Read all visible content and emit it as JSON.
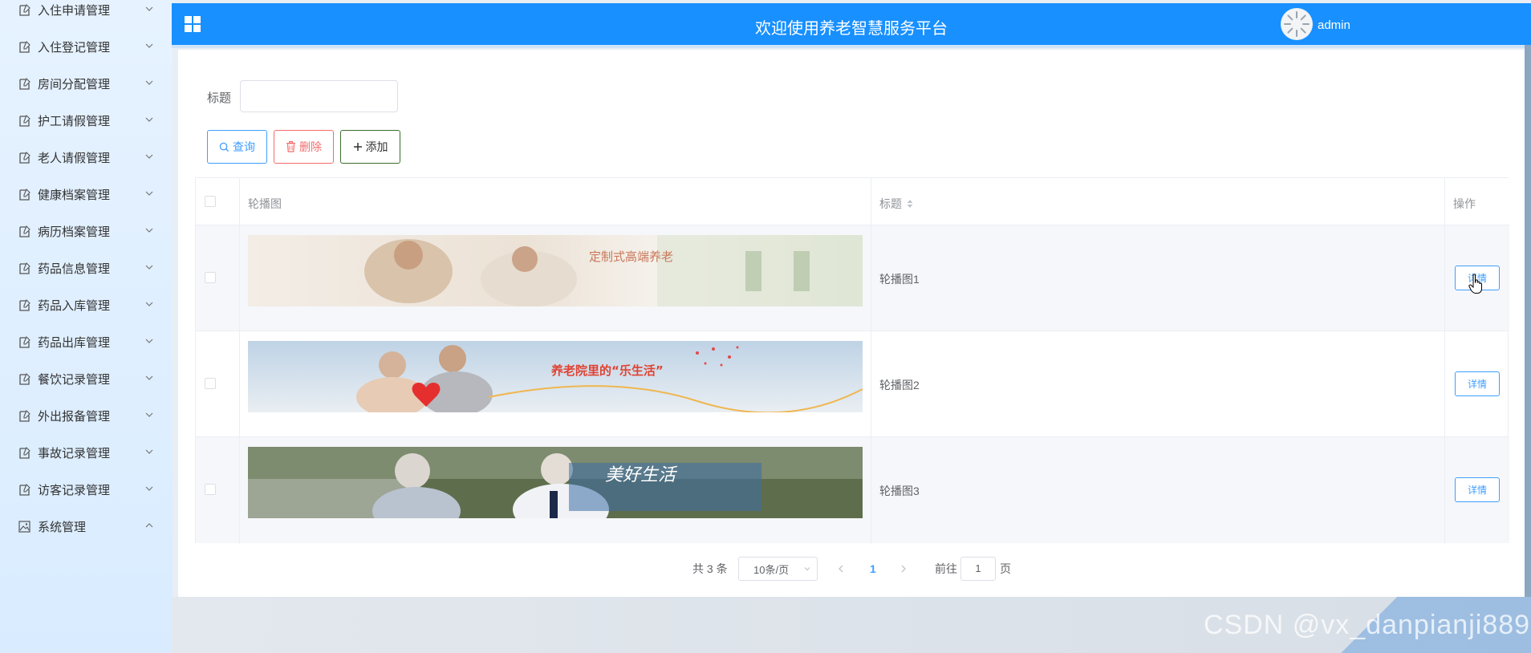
{
  "header": {
    "title": "欢迎使用养老智慧服务平台",
    "username": "admin"
  },
  "sidebar": {
    "items": [
      {
        "label": "入住申请管理",
        "icon": "document-icon",
        "expanded": false
      },
      {
        "label": "入住登记管理",
        "icon": "document-icon",
        "expanded": false
      },
      {
        "label": "房间分配管理",
        "icon": "document-icon",
        "expanded": false
      },
      {
        "label": "护工请假管理",
        "icon": "document-icon",
        "expanded": false
      },
      {
        "label": "老人请假管理",
        "icon": "document-icon",
        "expanded": false
      },
      {
        "label": "健康档案管理",
        "icon": "document-icon",
        "expanded": false
      },
      {
        "label": "病历档案管理",
        "icon": "document-icon",
        "expanded": false
      },
      {
        "label": "药品信息管理",
        "icon": "document-icon",
        "expanded": false
      },
      {
        "label": "药品入库管理",
        "icon": "document-icon",
        "expanded": false
      },
      {
        "label": "药品出库管理",
        "icon": "document-icon",
        "expanded": false
      },
      {
        "label": "餐饮记录管理",
        "icon": "document-icon",
        "expanded": false
      },
      {
        "label": "外出报备管理",
        "icon": "document-icon",
        "expanded": false
      },
      {
        "label": "事故记录管理",
        "icon": "document-icon",
        "expanded": false
      },
      {
        "label": "访客记录管理",
        "icon": "document-icon",
        "expanded": false
      },
      {
        "label": "系统管理",
        "icon": "image-icon",
        "expanded": true
      }
    ]
  },
  "search": {
    "label": "标题",
    "value": "",
    "placeholder": ""
  },
  "toolbar": {
    "search_label": "查询",
    "delete_label": "删除",
    "add_label": "添加"
  },
  "table": {
    "columns": {
      "image": "轮播图",
      "title": "标题",
      "actions": "操作"
    },
    "rows": [
      {
        "title": "轮播图1",
        "detail_label": "详情",
        "banner_text": "定制式高端养老"
      },
      {
        "title": "轮播图2",
        "detail_label": "详情",
        "banner_text": "养老院里的“乐生活”"
      },
      {
        "title": "轮播图3",
        "detail_label": "详情",
        "banner_text": "美好生活"
      }
    ]
  },
  "pagination": {
    "total": "共 3 条",
    "page_size": "10条/页",
    "current_page": "1",
    "goto_prefix": "前往",
    "goto_value": "1",
    "goto_suffix": "页"
  },
  "watermark": "CSDN @vx_danpianji889",
  "colors": {
    "primary": "#1890ff",
    "link": "#409eff",
    "danger": "#f56c6c",
    "sidebar_bg": "#e6f2ff"
  }
}
